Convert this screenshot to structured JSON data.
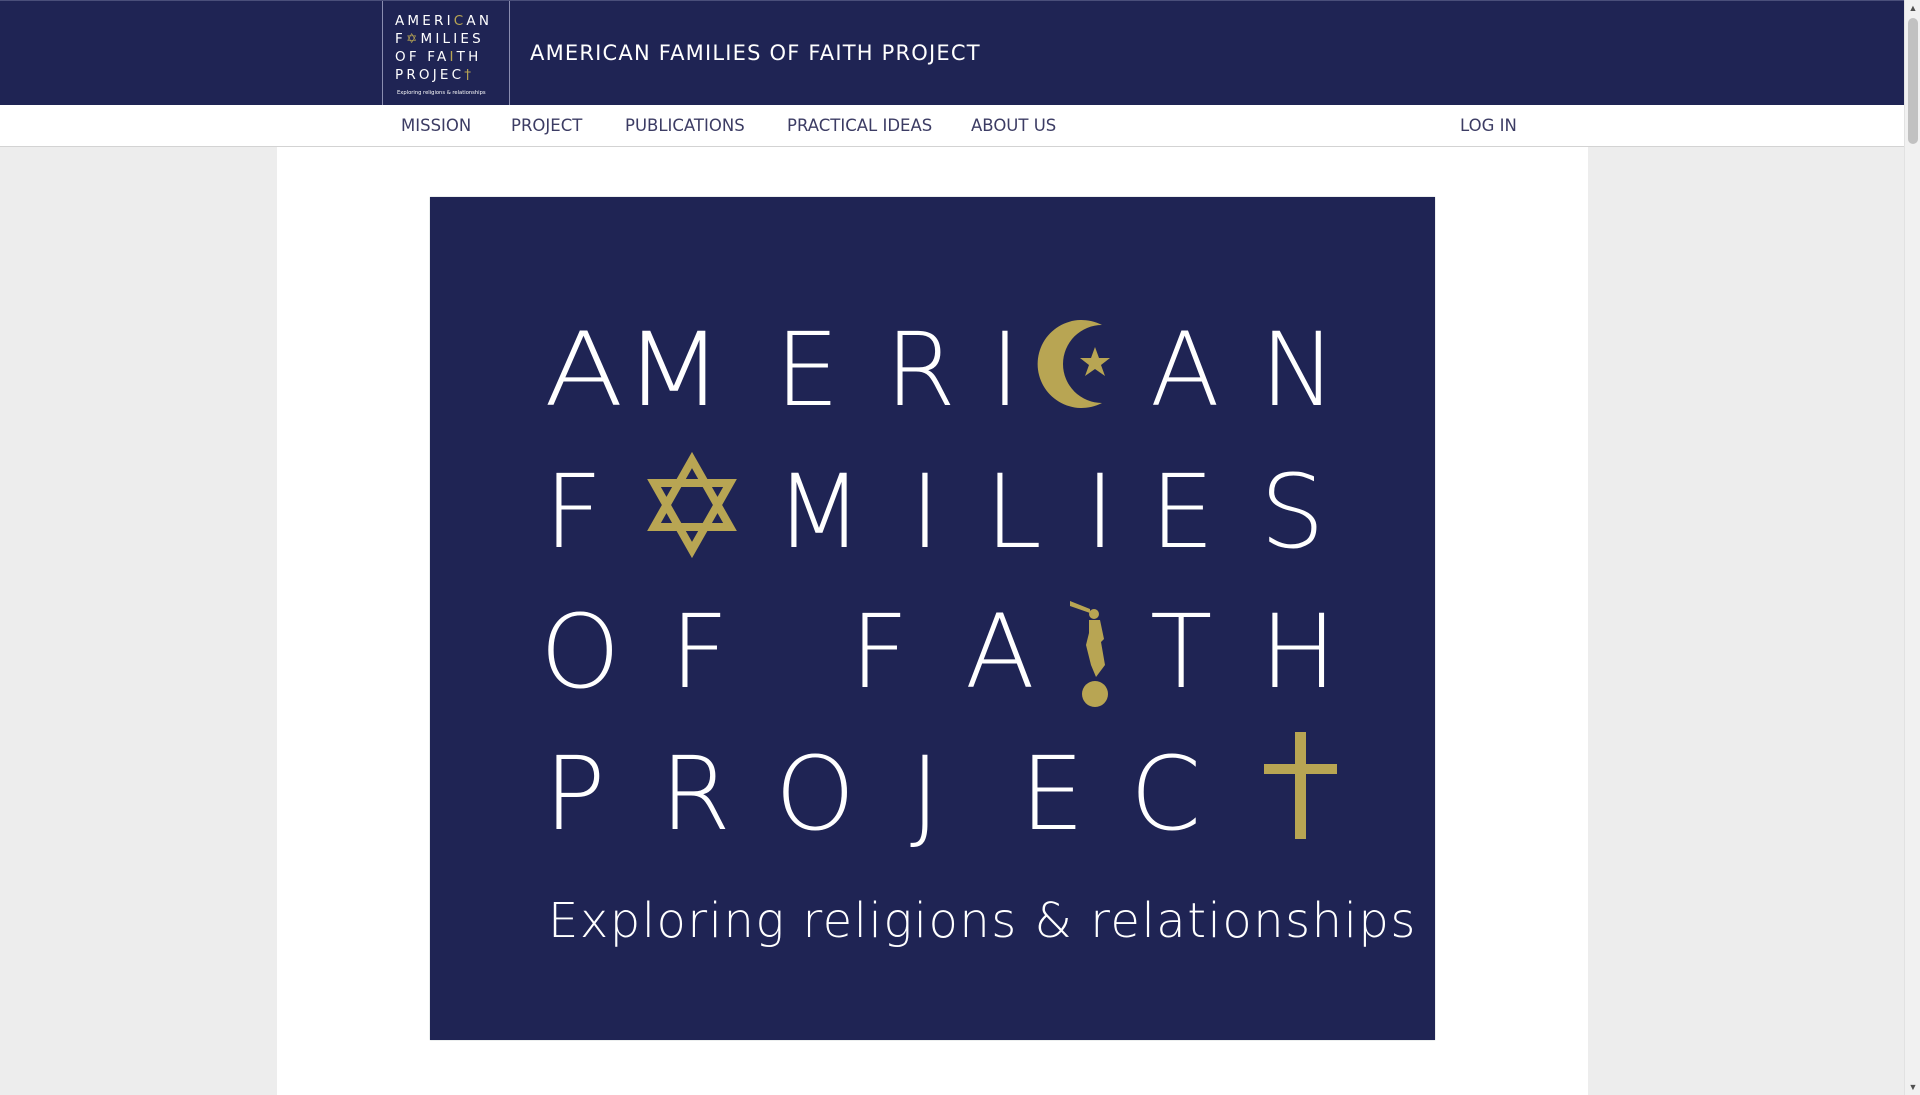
{
  "header": {
    "logo": {
      "lines": [
        "AMERICAN",
        "FAMILIES",
        "OF FAITH",
        "PROJECT"
      ],
      "tagline": "Exploring religions & relationships"
    },
    "title": "AMERICAN FAMILIES OF FAITH PROJECT"
  },
  "nav": {
    "items": [
      {
        "label": "MISSION"
      },
      {
        "label": "PROJECT"
      },
      {
        "label": "PUBLICATIONS"
      },
      {
        "label": "PRACTICAL IDEAS"
      },
      {
        "label": "ABOUT US"
      }
    ],
    "login_label": "LOG IN"
  },
  "hero": {
    "lines": [
      "AMERICAN",
      "FAMILIES",
      "OF FAITH",
      "PROJECT"
    ],
    "tagline": "Exploring religions & relationships"
  },
  "colors": {
    "navy": "#1f2454",
    "gold": "#b8a553",
    "nav_text": "#3c3c64",
    "page_bg": "#ededed"
  },
  "icons": [
    "crescent-star-icon",
    "star-of-david-icon",
    "angel-moroni-icon",
    "cross-icon"
  ]
}
